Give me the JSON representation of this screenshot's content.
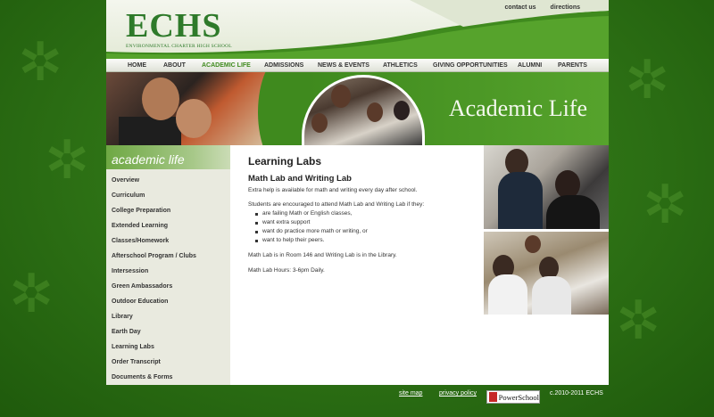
{
  "header": {
    "logo_letters": "ECHS",
    "logo_subtitle": "ENVIRONMENTAL CHARTER HIGH SCHOOL",
    "top_links": [
      "contact us",
      "directions"
    ]
  },
  "nav": {
    "items": [
      "HOME",
      "ABOUT",
      "ACADEMIC LIFE",
      "ADMISSIONS",
      "NEWS & EVENTS",
      "ATHLETICS",
      "GIVING OPPORTUNITIES",
      "ALUMNI",
      "PARENTS"
    ],
    "active": "ACADEMIC LIFE"
  },
  "banner": {
    "title": "Academic Life"
  },
  "sidebar": {
    "heading": "academic life",
    "items": [
      "Overview",
      "Curriculum",
      "College Preparation",
      "Extended Learning",
      "Classes/Homework",
      "Afterschool Program / Clubs",
      "Intersession",
      "Green Ambassadors",
      "Outdoor Education",
      "Library",
      "Earth Day",
      "Learning Labs",
      "Order Transcript",
      "Documents & Forms"
    ]
  },
  "content": {
    "title": "Learning Labs",
    "subtitle": "Math Lab and Writing Lab",
    "intro": "Extra help is available for math and writing every day after school.",
    "encourage": "Students are encouraged to attend Math Lab and Writing Lab if they:",
    "bullets": [
      "are failing Math or English classes,",
      "want extra support",
      "want do practice more math or writing, or",
      "want to help their peers."
    ],
    "rooms": "Math Lab is in Room 146 and Writing Lab is in the Library.",
    "hours": "Math Lab Hours: 3-6pm Daily."
  },
  "footer": {
    "site_map": "site map",
    "privacy": "privacy policy",
    "powerschool": "PowerSchool",
    "copyright": "c.2010-2011 ECHS"
  },
  "colors": {
    "brand_green": "#3f8a1e",
    "logo_green": "#2e7a2a",
    "nav_active": "#3f8a1e"
  }
}
